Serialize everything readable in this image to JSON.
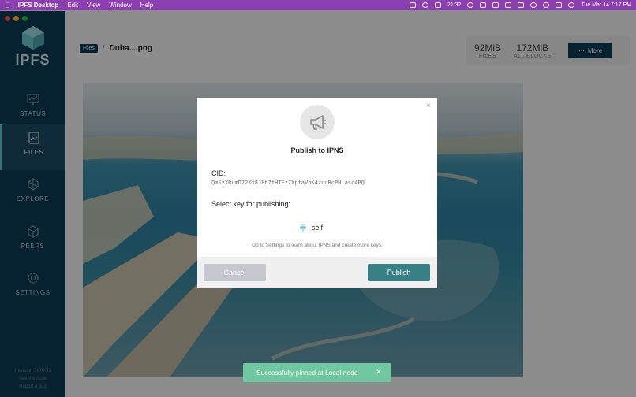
{
  "menubar": {
    "app_name": "IPFS Desktop",
    "items": [
      "Edit",
      "View",
      "Window",
      "Help"
    ],
    "cpu_temp": "21:32",
    "clock": "Tue Mar 14  7:17 PM"
  },
  "sidebar": {
    "logo_text": "IPFS",
    "nav": [
      {
        "label": "STATUS",
        "icon": "status-icon"
      },
      {
        "label": "FILES",
        "icon": "files-icon"
      },
      {
        "label": "EXPLORE",
        "icon": "explore-icon"
      },
      {
        "label": "PEERS",
        "icon": "peers-icon"
      },
      {
        "label": "SETTINGS",
        "icon": "settings-icon"
      }
    ],
    "footer": [
      "Revision 3e700fa",
      "See the code",
      "Report a bug"
    ]
  },
  "header": {
    "files_badge": "Files",
    "separator": "/",
    "file_name": "Duba....png",
    "stats": [
      {
        "value": "92MiB",
        "label": "FILES"
      },
      {
        "value": "172MiB",
        "label": "ALL BLOCKS"
      }
    ],
    "more_label": "More"
  },
  "modal": {
    "title": "Publish to IPNS",
    "cid_label": "CID:",
    "cid_value": "QmSzXRumD72Kx8J8b7fHTEzZXptaVhK4zuoRcPHLasc4PQ",
    "key_label": "Select key for publishing:",
    "key_option": "self",
    "hint": "Go to Settings to learn about IPNS and create more keys.",
    "cancel_label": "Cancel",
    "publish_label": "Publish",
    "close_symbol": "×"
  },
  "toast": {
    "message": "Successfully pinned at Local node",
    "close_symbol": "×"
  },
  "colors": {
    "menubar": "#8b3fb0",
    "sidebar": "#0b3a53",
    "accent": "#69c4cd",
    "publish": "#378085",
    "toast": "#70c8a3"
  }
}
